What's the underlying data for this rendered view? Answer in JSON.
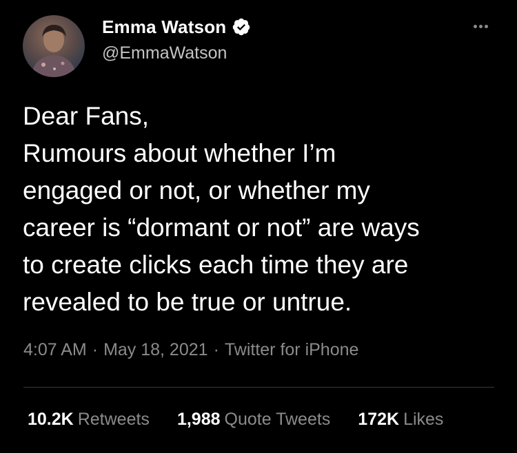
{
  "user": {
    "display_name": "Emma Watson",
    "handle": "@EmmaWatson",
    "verified_icon": "verified-badge-icon"
  },
  "tweet": {
    "lines": [
      "Dear Fans,",
      "Rumours about whether I’m",
      "engaged or not, or whether my",
      "career is “dormant or not” are ways",
      "to create clicks each time they are",
      "revealed to be true or untrue."
    ],
    "time": "4:07 AM",
    "date": "May 18, 2021",
    "source": "Twitter for iPhone",
    "separator": "·"
  },
  "stats": {
    "retweets_count": "10.2K",
    "retweets_label": "Retweets",
    "quotes_count": "1,988",
    "quotes_label": "Quote Tweets",
    "likes_count": "172K",
    "likes_label": "Likes"
  },
  "colors": {
    "background": "#000000",
    "text_primary": "#ffffff",
    "text_secondary": "#8b8b8b",
    "divider": "#3a3a3a"
  },
  "icons": {
    "more": "more-options-icon"
  }
}
